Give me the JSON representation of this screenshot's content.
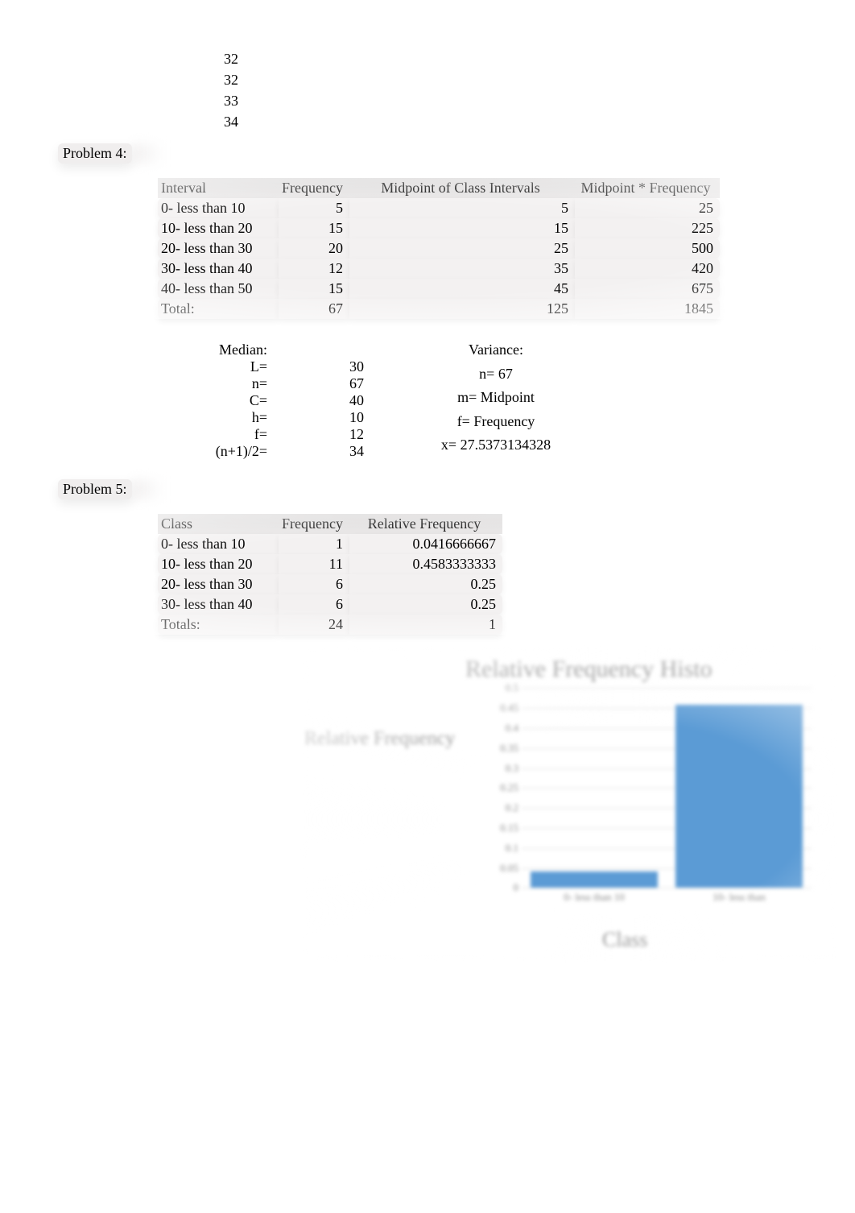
{
  "top_numbers": [
    "32",
    "32",
    "33",
    "34"
  ],
  "problem4": {
    "heading": "Problem 4:",
    "headers": [
      "Interval",
      "Frequency",
      "Midpoint of Class Intervals",
      "Midpoint * Frequency"
    ],
    "rows": [
      {
        "interval": "0- less than 10",
        "freq": "5",
        "mid": "5",
        "mf": "25"
      },
      {
        "interval": "10- less than 20",
        "freq": "15",
        "mid": "15",
        "mf": "225"
      },
      {
        "interval": "20- less than 30",
        "freq": "20",
        "mid": "25",
        "mf": "500"
      },
      {
        "interval": "30- less than 40",
        "freq": "12",
        "mid": "35",
        "mf": "420"
      },
      {
        "interval": "40- less than 50",
        "freq": "15",
        "mid": "45",
        "mf": "675"
      }
    ],
    "total": {
      "label": "Total:",
      "freq": "67",
      "mid": "125",
      "mf": "1845"
    },
    "median": {
      "title": "Median:",
      "items": [
        {
          "label": "L=",
          "value": "30"
        },
        {
          "label": "n=",
          "value": "67"
        },
        {
          "label": "C=",
          "value": "40"
        },
        {
          "label": "h=",
          "value": "10"
        },
        {
          "label": "f=",
          "value": "12"
        },
        {
          "label": "(n+1)/2=",
          "value": "34"
        }
      ]
    },
    "variance": {
      "title": "Variance:",
      "items": [
        "n= 67",
        "m= Midpoint",
        "f= Frequency",
        "x= 27.5373134328"
      ]
    }
  },
  "problem5": {
    "heading": "Problem 5:",
    "headers": [
      "Class",
      "Frequency",
      "Relative Frequency"
    ],
    "rows": [
      {
        "class": "0- less than 10",
        "freq": "1",
        "rel": "0.0416666667"
      },
      {
        "class": "10- less than 20",
        "freq": "11",
        "rel": "0.4583333333"
      },
      {
        "class": "20- less than 30",
        "freq": "6",
        "rel": "0.25"
      },
      {
        "class": "30- less than 40",
        "freq": "6",
        "rel": "0.25"
      }
    ],
    "totals": {
      "label": "Totals:",
      "freq": "24",
      "rel": "1"
    }
  },
  "chart_data": {
    "type": "bar",
    "title": "Relative Frequency Histo",
    "ylabel": "Relative Frequency",
    "xlabel": "Class",
    "ylim": [
      0,
      0.5
    ],
    "ticks": [
      0,
      0.05,
      0.1,
      0.15,
      0.2,
      0.25,
      0.3,
      0.35,
      0.4,
      0.45,
      0.5
    ],
    "categories": [
      "0- less than 10",
      "10- less than"
    ],
    "values": [
      0.0416666667,
      0.4583333333
    ]
  }
}
